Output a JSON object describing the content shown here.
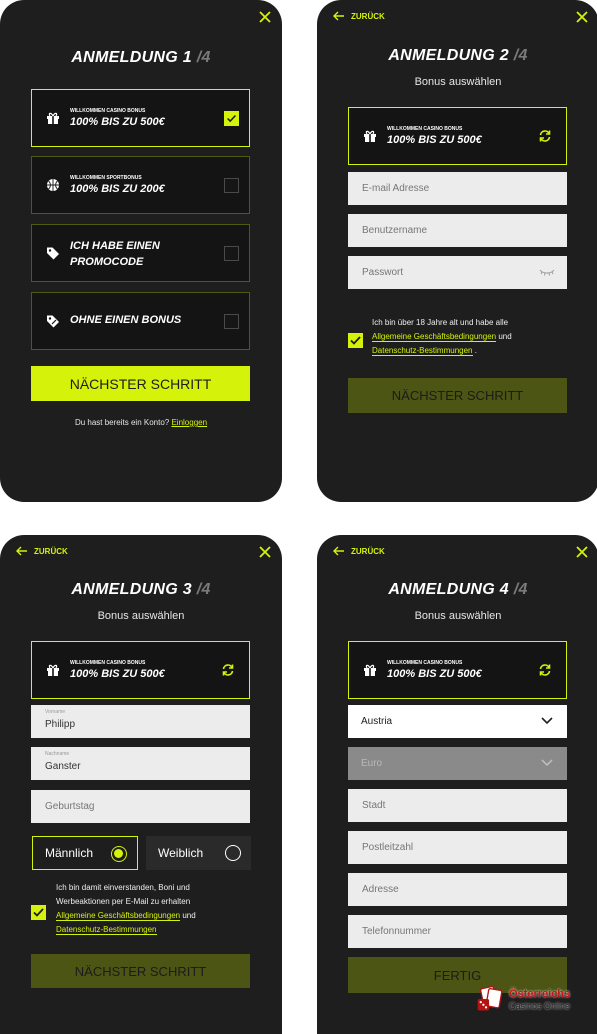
{
  "common": {
    "close_glyph": "✕",
    "back_label": "ZURÜCK",
    "step_total": "/4",
    "accent": "#d4f20a"
  },
  "step1": {
    "title": "ANMELDUNG 1",
    "options": [
      {
        "small": "WILLKOMMEN CASINO BONUS",
        "big": "100% BIS ZU 500€",
        "icon": "gift-icon",
        "checked": true
      },
      {
        "small": "WILLKOMMEN SPORTBONUS",
        "big": "100% BIS ZU 200€",
        "icon": "basketball-icon",
        "checked": false
      },
      {
        "line1": "ICH HABE EINEN",
        "line2": "PROMOCODE",
        "icon": "tag-icon",
        "checked": false
      },
      {
        "big": "OHNE EINEN BONUS",
        "icon": "no-discount-icon",
        "checked": false
      }
    ],
    "next_label": "NÄCHSTER SCHRITT",
    "footer_text": "Du hast bereits ein Konto?",
    "login_link": "Einloggen"
  },
  "step2": {
    "title": "ANMELDUNG 2",
    "subtitle": "Bonus auswählen",
    "bonus_small": "WILLKOMMEN CASINO BONUS",
    "bonus_big": "100% BIS ZU 500€",
    "email_placeholder": "E-mail Adresse",
    "username_placeholder": "Benutzername",
    "password_placeholder": "Passwort",
    "consent_text": "Ich bin über 18 Jahre alt und habe alle",
    "terms_link": "Allgemeine Geschäftsbedingungen",
    "and": "und",
    "privacy_link": "Datenschutz-Bestimmungen",
    "period": ".",
    "next_label": "NÄCHSTER SCHRITT"
  },
  "step3": {
    "title": "ANMELDUNG 3",
    "subtitle": "Bonus auswählen",
    "bonus_small": "WILLKOMMEN CASINO BONUS",
    "bonus_big": "100% BIS ZU 500€",
    "firstname_label": "Vorname",
    "firstname_value": "Philipp",
    "lastname_label": "Nachname",
    "lastname_value": "Ganster",
    "birthday_placeholder": "Geburtstag",
    "male_label": "Männlich",
    "female_label": "Weiblich",
    "consent_line1": "Ich bin damit einverstanden, Boni und",
    "consent_line2": "Werbeaktionen per E-Mail zu erhalten",
    "terms_link": "Allgemeine Geschäftsbedingungen",
    "and": "und",
    "privacy_link": "Datenschutz-Bestimmungen",
    "next_label": "NÄCHSTER SCHRITT"
  },
  "step4": {
    "title": "ANMELDUNG 4",
    "subtitle": "Bonus auswählen",
    "bonus_small": "WILLKOMMEN CASINO BONUS",
    "bonus_big": "100% BIS ZU 500€",
    "country_value": "Austria",
    "currency_value": "Euro",
    "city_placeholder": "Stadt",
    "zip_placeholder": "Postleitzahl",
    "address_placeholder": "Adresse",
    "phone_placeholder": "Telefonnummer",
    "finish_label": "FERTIG"
  },
  "watermark": {
    "line1": "Österreichs",
    "line2": "Casinos Online"
  }
}
